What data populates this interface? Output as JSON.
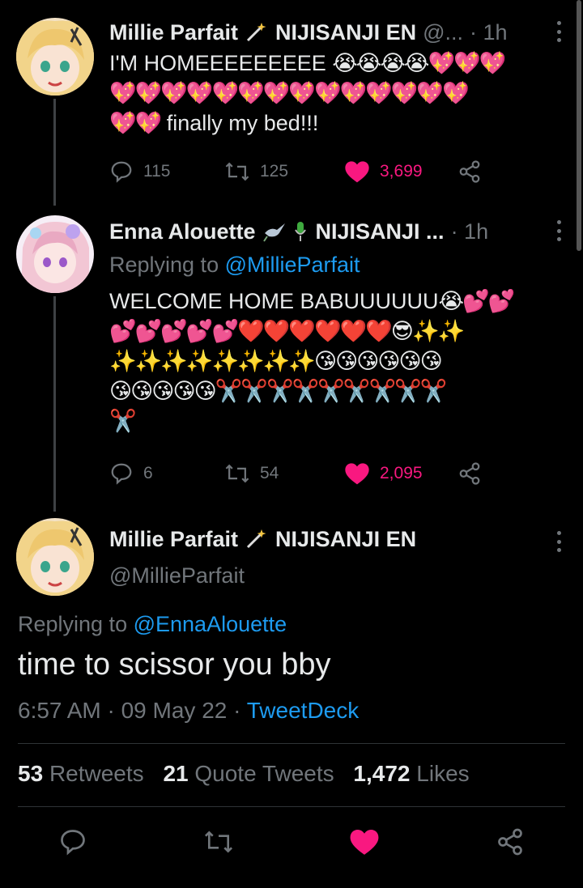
{
  "tweet1": {
    "name": "Millie Parfait",
    "affiliation": "NIJISANJI EN",
    "handle": "@...",
    "time": "· 1h",
    "text_main": "I'M HOMEEEEEEEEE",
    "emoji_line1": "😭😭😭😭💖💖💖",
    "emoji_line2": "💖💖💖💖💖💖💖💖💖💖💖💖💖💖",
    "emoji_line3": "💖💖",
    "text_tail": " finally my bed!!!",
    "replies": "115",
    "retweets": "125",
    "likes": "3,699"
  },
  "tweet2": {
    "name": "Enna Alouette",
    "affiliation": "NIJISANJI ...",
    "time": "· 1h",
    "replying_label": "Replying to",
    "replying_handle": "@MillieParfait",
    "text_main": "WELCOME HOME BABUUUUUU",
    "emoji_line1": "😭💕💕",
    "emoji_line2": "💕💕💕💕💕❤️❤️❤️❤️❤️❤️😎✨✨",
    "emoji_line3": "✨✨✨✨✨✨✨✨😘😘😘😘😘😘",
    "emoji_line4": "😘😘😘😘😘✂️✂️✂️✂️✂️✂️✂️✂️✂️",
    "emoji_line5": "✂️",
    "replies": "6",
    "retweets": "54",
    "likes": "2,095"
  },
  "main_tweet": {
    "name": "Millie Parfait",
    "affiliation": "NIJISANJI EN",
    "handle": "@MillieParfait",
    "replying_label": "Replying to",
    "replying_handle": "@EnnaAlouette",
    "text": "time to scissor you bby",
    "timestamp": "6:57 AM · 09 May 22 · ",
    "source": "TweetDeck",
    "retweets_count": "53",
    "retweets_label": "Retweets",
    "quotes_count": "21",
    "quotes_label": "Quote Tweets",
    "likes_count": "1,472",
    "likes_label": "Likes"
  },
  "colors": {
    "background": "#000000",
    "text": "#e7e9ea",
    "muted": "#71767b",
    "link": "#1d9bf0",
    "like": "#f91880",
    "divider": "#2f3336"
  },
  "icons": [
    "reply-icon",
    "retweet-icon",
    "heart-icon",
    "share-icon",
    "more-icon",
    "magic-wand-icon",
    "bird-icon",
    "microphone-icon"
  ]
}
